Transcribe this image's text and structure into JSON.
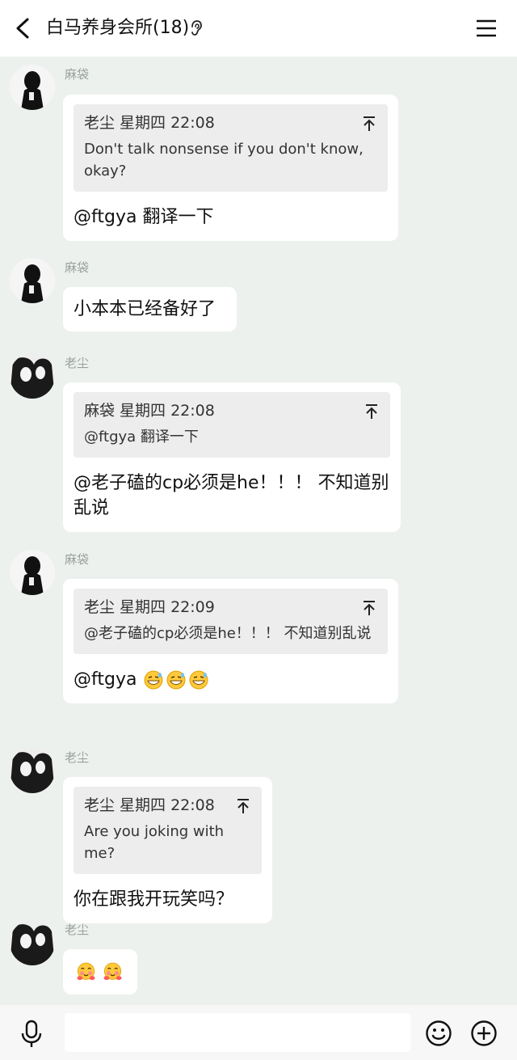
{
  "header": {
    "title": "白马养身会所(18)",
    "back_icon": "chevron-left-icon",
    "ear_icon": "ear-icon",
    "menu_icon": "hamburger-menu-icon"
  },
  "messages": [
    {
      "sender": "麻袋",
      "quote": {
        "head": "老尘 星期四 22:08",
        "text": "Don't talk nonsense if you don't know, okay?"
      },
      "text": "@ftgya 翻译一下"
    },
    {
      "sender": "麻袋",
      "text": "小本本已经备好了"
    },
    {
      "sender": "老尘",
      "quote": {
        "head": "麻袋 星期四 22:08",
        "text": "@ftgya 翻译一下"
      },
      "text": "@老子磕的cp必须是he！！！ 不知道别乱说"
    },
    {
      "sender": "麻袋",
      "quote": {
        "head": "老尘 星期四 22:09",
        "text": "@老子磕的cp必须是he！！！ 不知道别乱说"
      },
      "text": "@ftgya",
      "emojis": [
        "laughing-sweat-emoji",
        "laughing-sweat-emoji",
        "laughing-sweat-emoji"
      ]
    },
    {
      "sender": "老尘",
      "quote": {
        "head": "老尘 星期四 22:08",
        "text": "Are you joking with me?"
      },
      "text": "你在跟我开玩笑吗？"
    },
    {
      "sender": "老尘",
      "emojis": [
        "hug-face-emoji",
        "hug-face-emoji"
      ]
    }
  ],
  "input_bar": {
    "mic_icon": "microphone-icon",
    "placeholder": "",
    "value": "",
    "smile_icon": "smiley-icon",
    "plus_icon": "plus-circle-icon"
  },
  "colors": {
    "background": "#edf1ee",
    "bubble": "#ffffff",
    "quote_bg": "#ededed",
    "sender_name": "#9aa19c"
  }
}
